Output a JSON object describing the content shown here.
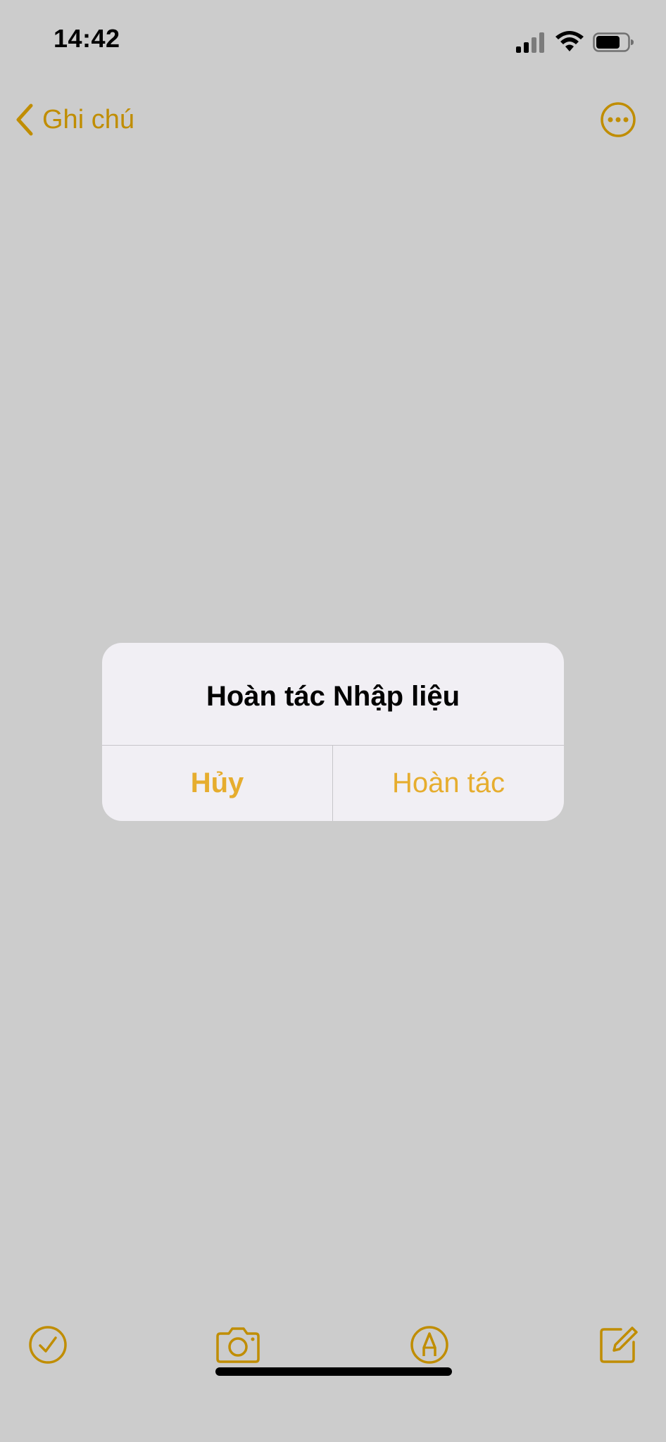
{
  "status_bar": {
    "time": "14:42",
    "icons": [
      "signal-icon",
      "wifi-icon",
      "battery-icon"
    ]
  },
  "nav": {
    "back_label": "Ghi chú",
    "back_icon": "chevron-left-icon",
    "more_icon": "ellipsis-circle-icon"
  },
  "toolbar": {
    "items": [
      "checklist-icon",
      "camera-icon",
      "markup-pen-icon",
      "compose-icon"
    ]
  },
  "alert": {
    "title": "Hoàn tác Nhập liệu",
    "cancel_label": "Hủy",
    "undo_label": "Hoàn tác"
  },
  "colors": {
    "accent": "#e6ad2e",
    "nav_accent": "#f0b100",
    "alert_background": "#f1eff4",
    "dim_overlay": "rgba(0,0,0,0.2)",
    "screen_background": "#ffffff"
  }
}
